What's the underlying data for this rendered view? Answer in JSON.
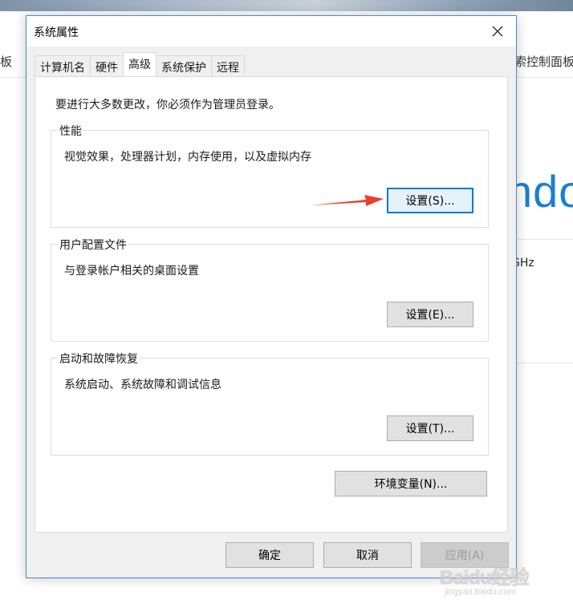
{
  "background": {
    "nav_left": "板",
    "nav_right": "索控制面板",
    "brand_partial": "ndo",
    "cpu_partial": "GHz"
  },
  "dialog": {
    "title": "系统属性",
    "tabs": [
      {
        "label": "计算机名"
      },
      {
        "label": "硬件"
      },
      {
        "label": "高级"
      },
      {
        "label": "系统保护"
      },
      {
        "label": "远程"
      }
    ],
    "active_tab": "高级",
    "admin_note": "要进行大多数更改，你必须作为管理员登录。",
    "groups": [
      {
        "label": "性能",
        "description": "视觉效果，处理器计划，内存使用，以及虚拟内存",
        "button": "设置(S)..."
      },
      {
        "label": "用户配置文件",
        "description": "与登录帐户相关的桌面设置",
        "button": "设置(E)..."
      },
      {
        "label": "启动和故障恢复",
        "description": "系统启动、系统故障和调试信息",
        "button": "设置(T)..."
      }
    ],
    "env_button": "环境变量(N)...",
    "footer": {
      "ok": "确定",
      "cancel": "取消",
      "apply": "应用(A)"
    }
  },
  "colors": {
    "accent": "#0078d7",
    "arrow": "#e8402f",
    "brand_blue": "#1a7fd4"
  },
  "watermark": {
    "logo": "Baidu经验",
    "url": "jingyan.baidu.com"
  }
}
